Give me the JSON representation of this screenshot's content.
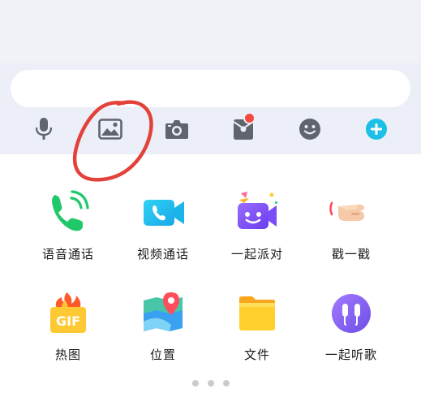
{
  "input": {
    "placeholder": ""
  },
  "toolbar": {
    "buttons": [
      {
        "name": "voice",
        "icon": "microphone-icon"
      },
      {
        "name": "image",
        "icon": "image-icon"
      },
      {
        "name": "camera",
        "icon": "camera-icon"
      },
      {
        "name": "red-packet",
        "icon": "red-packet-icon",
        "badge": true
      },
      {
        "name": "emoji",
        "icon": "emoji-icon"
      },
      {
        "name": "more",
        "icon": "plus-circle-icon"
      }
    ],
    "accent_color": "#1cc0e6",
    "icon_color": "#5f646d"
  },
  "annotation": {
    "color": "#e3423a"
  },
  "panel": {
    "items": [
      {
        "label": "语音通话",
        "icon": "voice-call-icon"
      },
      {
        "label": "视频通话",
        "icon": "video-call-icon"
      },
      {
        "label": "一起派对",
        "icon": "party-icon"
      },
      {
        "label": "戳一戳",
        "icon": "poke-icon"
      },
      {
        "label": "热图",
        "icon": "gif-icon"
      },
      {
        "label": "位置",
        "icon": "location-icon"
      },
      {
        "label": "文件",
        "icon": "file-icon"
      },
      {
        "label": "一起听歌",
        "icon": "music-icon"
      }
    ]
  },
  "pager": {
    "pages": 3,
    "current": 1
  }
}
